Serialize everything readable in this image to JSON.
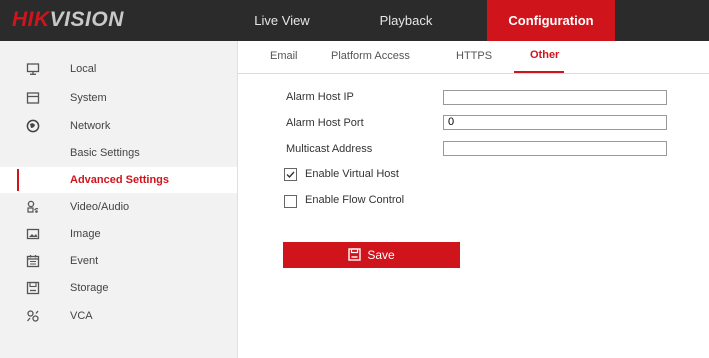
{
  "brand": {
    "logo_hik": "HIK",
    "logo_vision": "VISION"
  },
  "nav": {
    "live_view": "Live View",
    "playback": "Playback",
    "configuration": "Configuration"
  },
  "sidebar": {
    "items": [
      {
        "label": "Local",
        "icon": "monitor-icon"
      },
      {
        "label": "System",
        "icon": "system-icon"
      },
      {
        "label": "Network",
        "icon": "globe-icon"
      },
      {
        "label": "Basic Settings"
      },
      {
        "label": "Advanced Settings",
        "active": true
      },
      {
        "label": "Video/Audio",
        "icon": "video-audio-icon"
      },
      {
        "label": "Image",
        "icon": "image-icon"
      },
      {
        "label": "Event",
        "icon": "calendar-icon"
      },
      {
        "label": "Storage",
        "icon": "storage-icon"
      },
      {
        "label": "VCA",
        "icon": "vca-icon"
      }
    ]
  },
  "tabs": [
    {
      "label": "Email"
    },
    {
      "label": "Platform Access"
    },
    {
      "label": "HTTPS"
    },
    {
      "label": "Other",
      "active": true
    }
  ],
  "form": {
    "alarm_host_ip_label": "Alarm Host IP",
    "alarm_host_ip_value": "",
    "alarm_host_port_label": "Alarm Host Port",
    "alarm_host_port_value": "0",
    "multicast_address_label": "Multicast Address",
    "multicast_address_value": "",
    "enable_virtual_host_label": "Enable Virtual Host",
    "enable_virtual_host_checked": true,
    "enable_flow_control_label": "Enable Flow Control",
    "enable_flow_control_checked": false
  },
  "save_label": "Save",
  "colors": {
    "accent": "#d0141c",
    "topbar": "#2b2b2b",
    "sidebar": "#f2f2f2"
  }
}
